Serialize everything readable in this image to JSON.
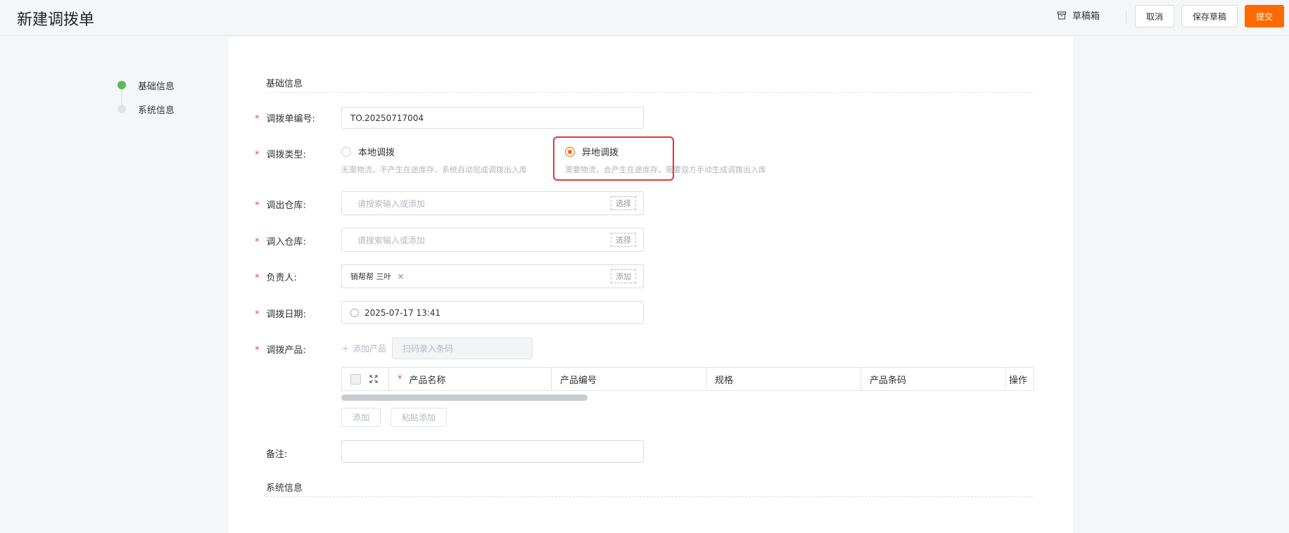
{
  "header": {
    "title": "新建调拨单",
    "drafts_label": "草稿箱",
    "cancel_label": "取消",
    "save_draft_label": "保存草稿",
    "submit_label": "提交",
    "accent_color": "#ff6a00"
  },
  "steps": [
    {
      "label": "基础信息",
      "active": true
    },
    {
      "label": "系统信息",
      "active": false
    }
  ],
  "sections": {
    "basic": "基础信息",
    "system": "系统信息"
  },
  "form": {
    "order_no": {
      "label": "调拨单编号:",
      "required": true,
      "value": "TO.20250717004"
    },
    "transfer_type": {
      "label": "调拨类型:",
      "required": true,
      "options": [
        {
          "label": "本地调拨",
          "desc": "无需物流，不产生在途库存，系统自动完成调拨出入库",
          "checked": false
        },
        {
          "label": "异地调拨",
          "desc": "需要物流，会产生在途库存，需要双方手动生成调拨出入库",
          "checked": true
        }
      ]
    },
    "out_warehouse": {
      "label": "调出仓库:",
      "required": true,
      "placeholder": "请搜索输入或添加",
      "action": "选择"
    },
    "in_warehouse": {
      "label": "调入仓库:",
      "required": true,
      "placeholder": "请搜索输入或添加",
      "action": "选择"
    },
    "owner": {
      "label": "负责人:",
      "required": true,
      "tag": "销帮帮 三叶",
      "tag_remove": "×",
      "action": "添加"
    },
    "date": {
      "label": "调拨日期:",
      "required": true,
      "value": "2025-07-17 13:41"
    },
    "products": {
      "label": "调拨产品:",
      "required": true,
      "add_label": "添加产品",
      "scan_placeholder": "扫码录入条码",
      "columns": [
        "产品名称",
        "产品编号",
        "规格",
        "产品条码",
        "操作"
      ],
      "add_button": "添加",
      "paste_button": "粘贴添加"
    },
    "remark": {
      "label": "备注:",
      "required": false,
      "value": ""
    }
  }
}
